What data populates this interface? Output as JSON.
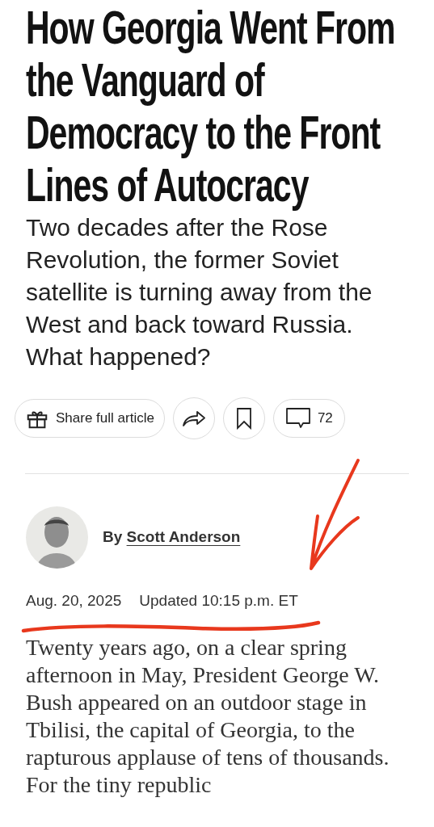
{
  "headline": "How Georgia Went From the Vanguard of Democracy to the Front Lines of Autocracy",
  "summary": "Two decades after the Rose Revolution, the former Soviet satellite is turning away from the West and back toward Russia. What happened?",
  "actions": {
    "share_label": "Share full article",
    "comment_count": "72"
  },
  "byline": {
    "prefix": "By",
    "author": "Scott Anderson"
  },
  "dateline": {
    "date": "Aug. 20, 2025",
    "updated": "Updated 10:15 p.m. ET"
  },
  "body": "Twenty years ago, on a clear spring afternoon in May, President George W. Bush appeared on an outdoor stage in Tbilisi, the capital of Georgia, to the rapturous applause of tens of thousands. For the tiny republic"
}
